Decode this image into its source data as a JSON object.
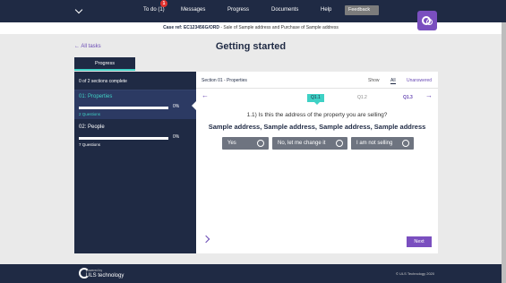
{
  "nav": {
    "todo_label": "To do (1)",
    "todo_badge": "1",
    "messages_label": "Messages",
    "progress_label": "Progress",
    "documents_label": "Documents",
    "help_label": "Help",
    "feedback_label": "Feedback"
  },
  "case_bar": {
    "prefix": "Case ref:",
    "ref": "EC123456G/ORD",
    "description": "- Sale of Sample address and Purchase of Sample address"
  },
  "back_link": "← All tasks",
  "page_title": "Getting started",
  "left_panel": {
    "tab_label": "Progress",
    "summary": "0 of 2 sections complete",
    "sections": [
      {
        "title": "01: Properties",
        "percent": "0%",
        "questions": "2 Questions",
        "active": true
      },
      {
        "title": "02: People",
        "percent": "0%",
        "questions": "7 Questions",
        "active": false
      }
    ]
  },
  "main": {
    "section_header": "Section 01 - Properties",
    "show_label": "Show",
    "filter_all": "All",
    "filter_unanswered": "Unanswered",
    "question_tabs": [
      "Q1.1",
      "Q1.2",
      "Q1.3"
    ],
    "question": "1.1) Is this the address of the property you are selling?",
    "address": "Sample address, Sample address, Sample address, Sample address",
    "options": [
      "Yes",
      "No, let me change it",
      "I am not selling"
    ],
    "next_label": "Next"
  },
  "footer": {
    "powered_by": "powered by",
    "brand": "ULS technology",
    "copyright": "© ULS Technology 2020"
  },
  "colors": {
    "navy": "#1f2a44",
    "teal": "#3fd1c5",
    "purple": "#7a4fbf",
    "badge_red": "#e0322f"
  }
}
